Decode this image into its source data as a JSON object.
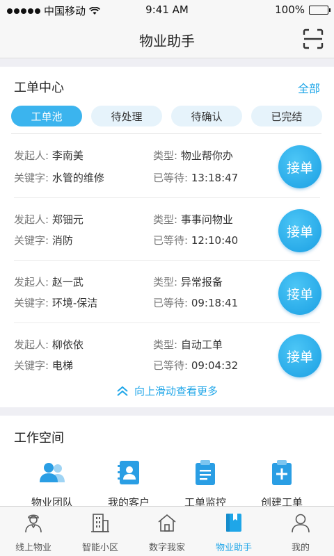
{
  "status_bar": {
    "carrier": "中国移动",
    "time": "9:41 AM",
    "battery": "100%"
  },
  "nav": {
    "title": "物业助手"
  },
  "order_center": {
    "title": "工单中心",
    "all_link": "全部",
    "tabs": [
      {
        "label": "工单池",
        "active": true
      },
      {
        "label": "待处理",
        "active": false
      },
      {
        "label": "待确认",
        "active": false
      },
      {
        "label": "已完结",
        "active": false
      }
    ],
    "labels": {
      "initiator": "发起人:",
      "keyword": "关键字:",
      "type": "类型:",
      "waited": "已等待:"
    },
    "take_label": "接单",
    "orders": [
      {
        "initiator": "李南美",
        "type": "物业帮你办",
        "keyword": "水管的维修",
        "waited": "13:18:47"
      },
      {
        "initiator": "郑钿元",
        "type": "事事问物业",
        "keyword": "消防",
        "waited": "12:10:40"
      },
      {
        "initiator": "赵一武",
        "type": "异常报备",
        "keyword": "环境-保洁",
        "waited": "09:18:41"
      },
      {
        "initiator": "柳依依",
        "type": "自动工单",
        "keyword": "电梯",
        "waited": "09:04:32"
      }
    ],
    "more_label": "向上滑动查看更多"
  },
  "workspace": {
    "title": "工作空间",
    "items": [
      {
        "label": "物业团队",
        "icon": "team-icon"
      },
      {
        "label": "我的客户",
        "icon": "contacts-icon"
      },
      {
        "label": "工单监控",
        "icon": "clipboard-list-icon"
      },
      {
        "label": "创建工单",
        "icon": "clipboard-add-icon"
      }
    ]
  },
  "tab_bar": {
    "items": [
      {
        "label": "线上物业",
        "icon": "butler-icon",
        "active": false
      },
      {
        "label": "智能小区",
        "icon": "building-icon",
        "active": false
      },
      {
        "label": "数字我家",
        "icon": "home-icon",
        "active": false
      },
      {
        "label": "物业助手",
        "icon": "book-icon",
        "active": true
      },
      {
        "label": "我的",
        "icon": "user-icon",
        "active": false
      }
    ]
  },
  "colors": {
    "accent": "#1fa6e8",
    "tab_active": "#3bb4ee",
    "tab_inactive": "#e6f3fb"
  }
}
